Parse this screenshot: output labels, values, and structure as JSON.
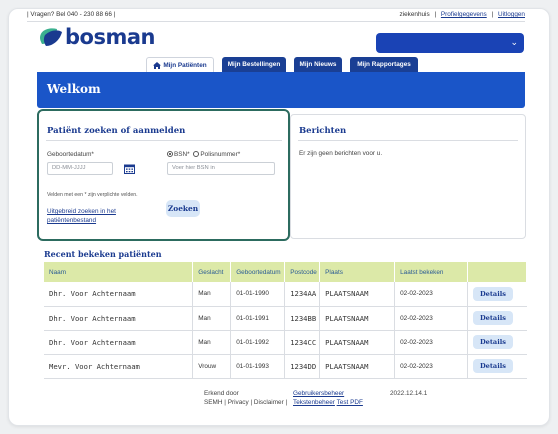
{
  "topbar": {
    "phone": "| Vragen? Bel 040 - 230 88 66 |",
    "hospital": "ziekenhuis",
    "sep1": "|",
    "profile": "Profielgegevens",
    "sep2": "|",
    "logout": "Uitloggen"
  },
  "brand": {
    "name": "bosman",
    "icon": "leaf-logo-icon"
  },
  "tabs": [
    {
      "label": "Mijn Patiënten",
      "icon": "home-icon",
      "style": "light"
    },
    {
      "label": "Mijn Bestellingen",
      "style": "dark"
    },
    {
      "label": "Mijn Nieuws",
      "style": "dark"
    },
    {
      "label": "Mijn Rapportages",
      "style": "dark"
    }
  ],
  "banner": {
    "title": "Welkom"
  },
  "search": {
    "title": "Patiënt zoeken of aanmelden",
    "dob_label": "Geboortedatum*",
    "dob_placeholder": "DD-MM-JJJJ",
    "radio_bsn": "BSN*",
    "radio_polis": "Polisnummer*",
    "bsn_placeholder": "Voer hier BSN in",
    "required_note": "Velden met een * zijn verplichte velden.",
    "advanced_link": "Uitgebreid zoeken in het patiëntenbestand",
    "search_button": "Zoeken"
  },
  "messages": {
    "title": "Berichten",
    "empty": "Er zijn geen berichten voor u."
  },
  "recent": {
    "title": "Recent bekeken patiënten",
    "columns": [
      "Naam",
      "Geslacht",
      "Geboortedatum",
      "Postcode",
      "Plaats",
      "Laatst bekeken",
      ""
    ],
    "rows": [
      {
        "naam": "Dhr. Voor Achternaam",
        "geslacht": "Man",
        "geboortedatum": "01-01-1990",
        "postcode": "1234AA",
        "plaats": "PLAATSNAAM",
        "laatst": "02-02-2023",
        "action": "Details"
      },
      {
        "naam": "Dhr. Voor Achternaam",
        "geslacht": "Man",
        "geboortedatum": "01-01-1991",
        "postcode": "1234BB",
        "plaats": "PLAATSNAAM",
        "laatst": "02-02-2023",
        "action": "Details"
      },
      {
        "naam": "Dhr. Voor Achternaam",
        "geslacht": "Man",
        "geboortedatum": "01-01-1992",
        "postcode": "1234CC",
        "plaats": "PLAATSNAAM",
        "laatst": "02-02-2023",
        "action": "Details"
      },
      {
        "naam": "Mevr. Voor Achternaam",
        "geslacht": "Vrouw",
        "geboortedatum": "01-01-1993",
        "postcode": "1234DD",
        "plaats": "PLAATSNAAM",
        "laatst": "02-02-2023",
        "action": "Details"
      }
    ]
  },
  "footer": {
    "erkend": "Erkend door",
    "semh": "SEMH",
    "sep_a": "|",
    "privacy": "Privacy",
    "sep_b": "|",
    "disclaimer": "Disclaimer",
    "sep_c": "|",
    "gebruikersbeheer": "Gebruikersbeheer",
    "tekstenbeheer": "Tekstenbeheer",
    "testpdf": "Test PDF",
    "version": "2022.12.14.1"
  },
  "colors": {
    "brand_blue": "#1a3a8f",
    "banner": "#1a55c8",
    "panel_border": "#2c6b5f",
    "table_header": "#dce9a8",
    "leaf_green": "#3bb08f"
  }
}
